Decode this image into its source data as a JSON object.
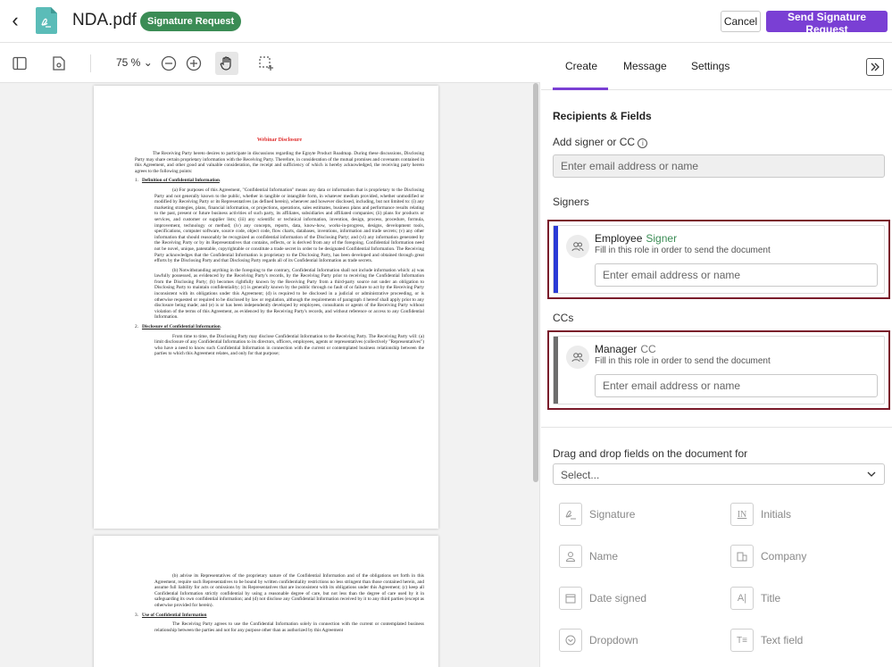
{
  "header": {
    "file_name": "NDA.pdf",
    "badge": "Signature Request",
    "cancel_label": "Cancel",
    "send_label": "Send Signature Request"
  },
  "toolbar": {
    "zoom": "75 %"
  },
  "document": {
    "title": "Webinar Disclosure",
    "intro": "The Receiving Party hereto desires to participate in discussions regarding the Egnyte Product Roadmap. During these discussions, Disclosing Party may share certain proprietary information with the Receiving Party. Therefore, in consideration of the mutual promises and covenants contained in this Agreement, and other good and valuable consideration, the receipt and sufficiency of which is hereby acknowledged, the receiving party hereto agrees to the following points:",
    "s1_num": "1.",
    "s1_title": "Definition of Confidential Information",
    "s1_a": "(a) For purposes of this Agreement, \"Confidential Information\" means any data or information that is proprietary to the Disclosing Party and not generally known to the public, whether in tangible or intangible form, in whatever medium provided, whether unmodified or modified by Receiving Party or its Representatives (as defined herein), whenever and however disclosed, including, but not limited to: (i) any marketing strategies, plans, financial information, or projections, operations, sales estimates, business plans and performance results relating to the past, present or future business activities of such party, its affiliates, subsidiaries and affiliated companies; (ii) plans for products or services, and customer or supplier lists; (iii) any scientific or technical information, invention, design, process, procedure, formula, improvement, technology or method; (iv) any concepts, reports, data, know-how, works-in-progress, designs, development tools, specifications, computer software, source code, object code, flow charts, databases, inventions, information and trade secrets; (v) any other information that should reasonably be recognized as confidential information of the Disclosing Party; and (vi) any information generated by the Receiving Party or by its Representatives that contains, reflects, or is derived from any of the foregoing. Confidential Information need not be novel, unique, patentable, copyrightable or constitute a trade secret in order to be designated Confidential Information. The Receiving Party acknowledges that the Confidential Information is proprietary to the Disclosing Party, has been developed and obtained through great efforts by the Disclosing Party and that Disclosing Party regards all of its Confidential Information as trade secrets.",
    "s1_b": "(b) Notwithstanding anything in the foregoing to the contrary, Confidential Information shall not include information which: a) was lawfully possessed, as evidenced by the Receiving Party's records, by the Receiving Party prior to receiving the Confidential Information from the Disclosing Party; (b) becomes rightfully known by the Receiving Party from a third-party source not under an obligation to Disclosing Party to maintain confidentiality; (c) is generally known by the public through no fault of or failure to act by the Receiving Party inconsistent with its obligations under this Agreement; (d) is required to be disclosed in a judicial or administrative proceeding, or is otherwise requested or required to be disclosed by law or regulation, although the requirements of paragraph 4 hereof shall apply prior to any disclosure being made; and (e) is or has been independently developed by employees, consultants or agents of the Receiving Party without violation of the terms of this Agreement, as evidenced by the Receiving Party's records, and without reference or access to any Confidential Information.",
    "s2_num": "2.",
    "s2_title": "Disclosure of Confidential Information",
    "s2_text": "From time to time, the Disclosing Party may disclose Confidential Information to the Receiving Party. The Receiving Party will: (a) limit disclosure of any Confidential Information to its directors, officers, employees, agents or representatives (collectively \"Representatives\") who have a need to know such Confidential Information in connection with the current or contemplated business relationship between the parties to which this Agreement relates, and only for that purpose;",
    "p2_b": "(b) advise its Representatives of the proprietary nature of the Confidential Information and of the obligations set forth in this Agreement, require such Representatives to be bound by written confidentiality restrictions no less stringent than those contained herein, and assume full liability for acts or omissions by its Representatives that are inconsistent with its obligations under this Agreement; (c) keep all Confidential Information strictly confidential by using a reasonable degree of care, but not less than the degree of care used by it in safeguarding its own confidential information; and (d) not disclose any Confidential Information received by it to any third parties (except as otherwise provided for herein).",
    "s3_num": "3.",
    "s3_title": "Use of Confidential Information",
    "s3_text": "The Receiving Party agrees to use the Confidential Information solely in connection with the current or contemplated business relationship between the parties and not for any purpose other than as authorized by this Agreement"
  },
  "panel": {
    "tabs": [
      "Create",
      "Message",
      "Settings"
    ],
    "section_title": "Recipients & Fields",
    "add_label": "Add signer or CC",
    "add_placeholder": "Enter email address or name",
    "signers_label": "Signers",
    "ccs_label": "CCs",
    "signer": {
      "name": "Employee",
      "type": "Signer",
      "desc": "Fill in this role in order to send the document",
      "placeholder": "Enter email address or name",
      "bar_color": "#2b3bd6",
      "type_color": "#3b8c55"
    },
    "cc": {
      "name": "Manager",
      "type": "CC",
      "desc": "Fill in this role in order to send the document",
      "placeholder": "Enter email address or name",
      "bar_color": "#6e6e6e",
      "type_color": "#777777"
    },
    "drag_label": "Drag and drop fields on the document for",
    "select_value": "Select...",
    "fields": [
      {
        "label": "Signature",
        "icon": "signature-icon"
      },
      {
        "label": "Initials",
        "icon": "initials-icon"
      },
      {
        "label": "Name",
        "icon": "person-icon"
      },
      {
        "label": "Company",
        "icon": "building-icon"
      },
      {
        "label": "Date signed",
        "icon": "calendar-icon"
      },
      {
        "label": "Title",
        "icon": "title-icon"
      },
      {
        "label": "Dropdown",
        "icon": "dropdown-icon"
      },
      {
        "label": "Text field",
        "icon": "text-field-icon"
      }
    ]
  },
  "colors": {
    "accent": "#7a3fd4",
    "badge": "#3b8c55",
    "card_border": "#7a1a2a"
  }
}
